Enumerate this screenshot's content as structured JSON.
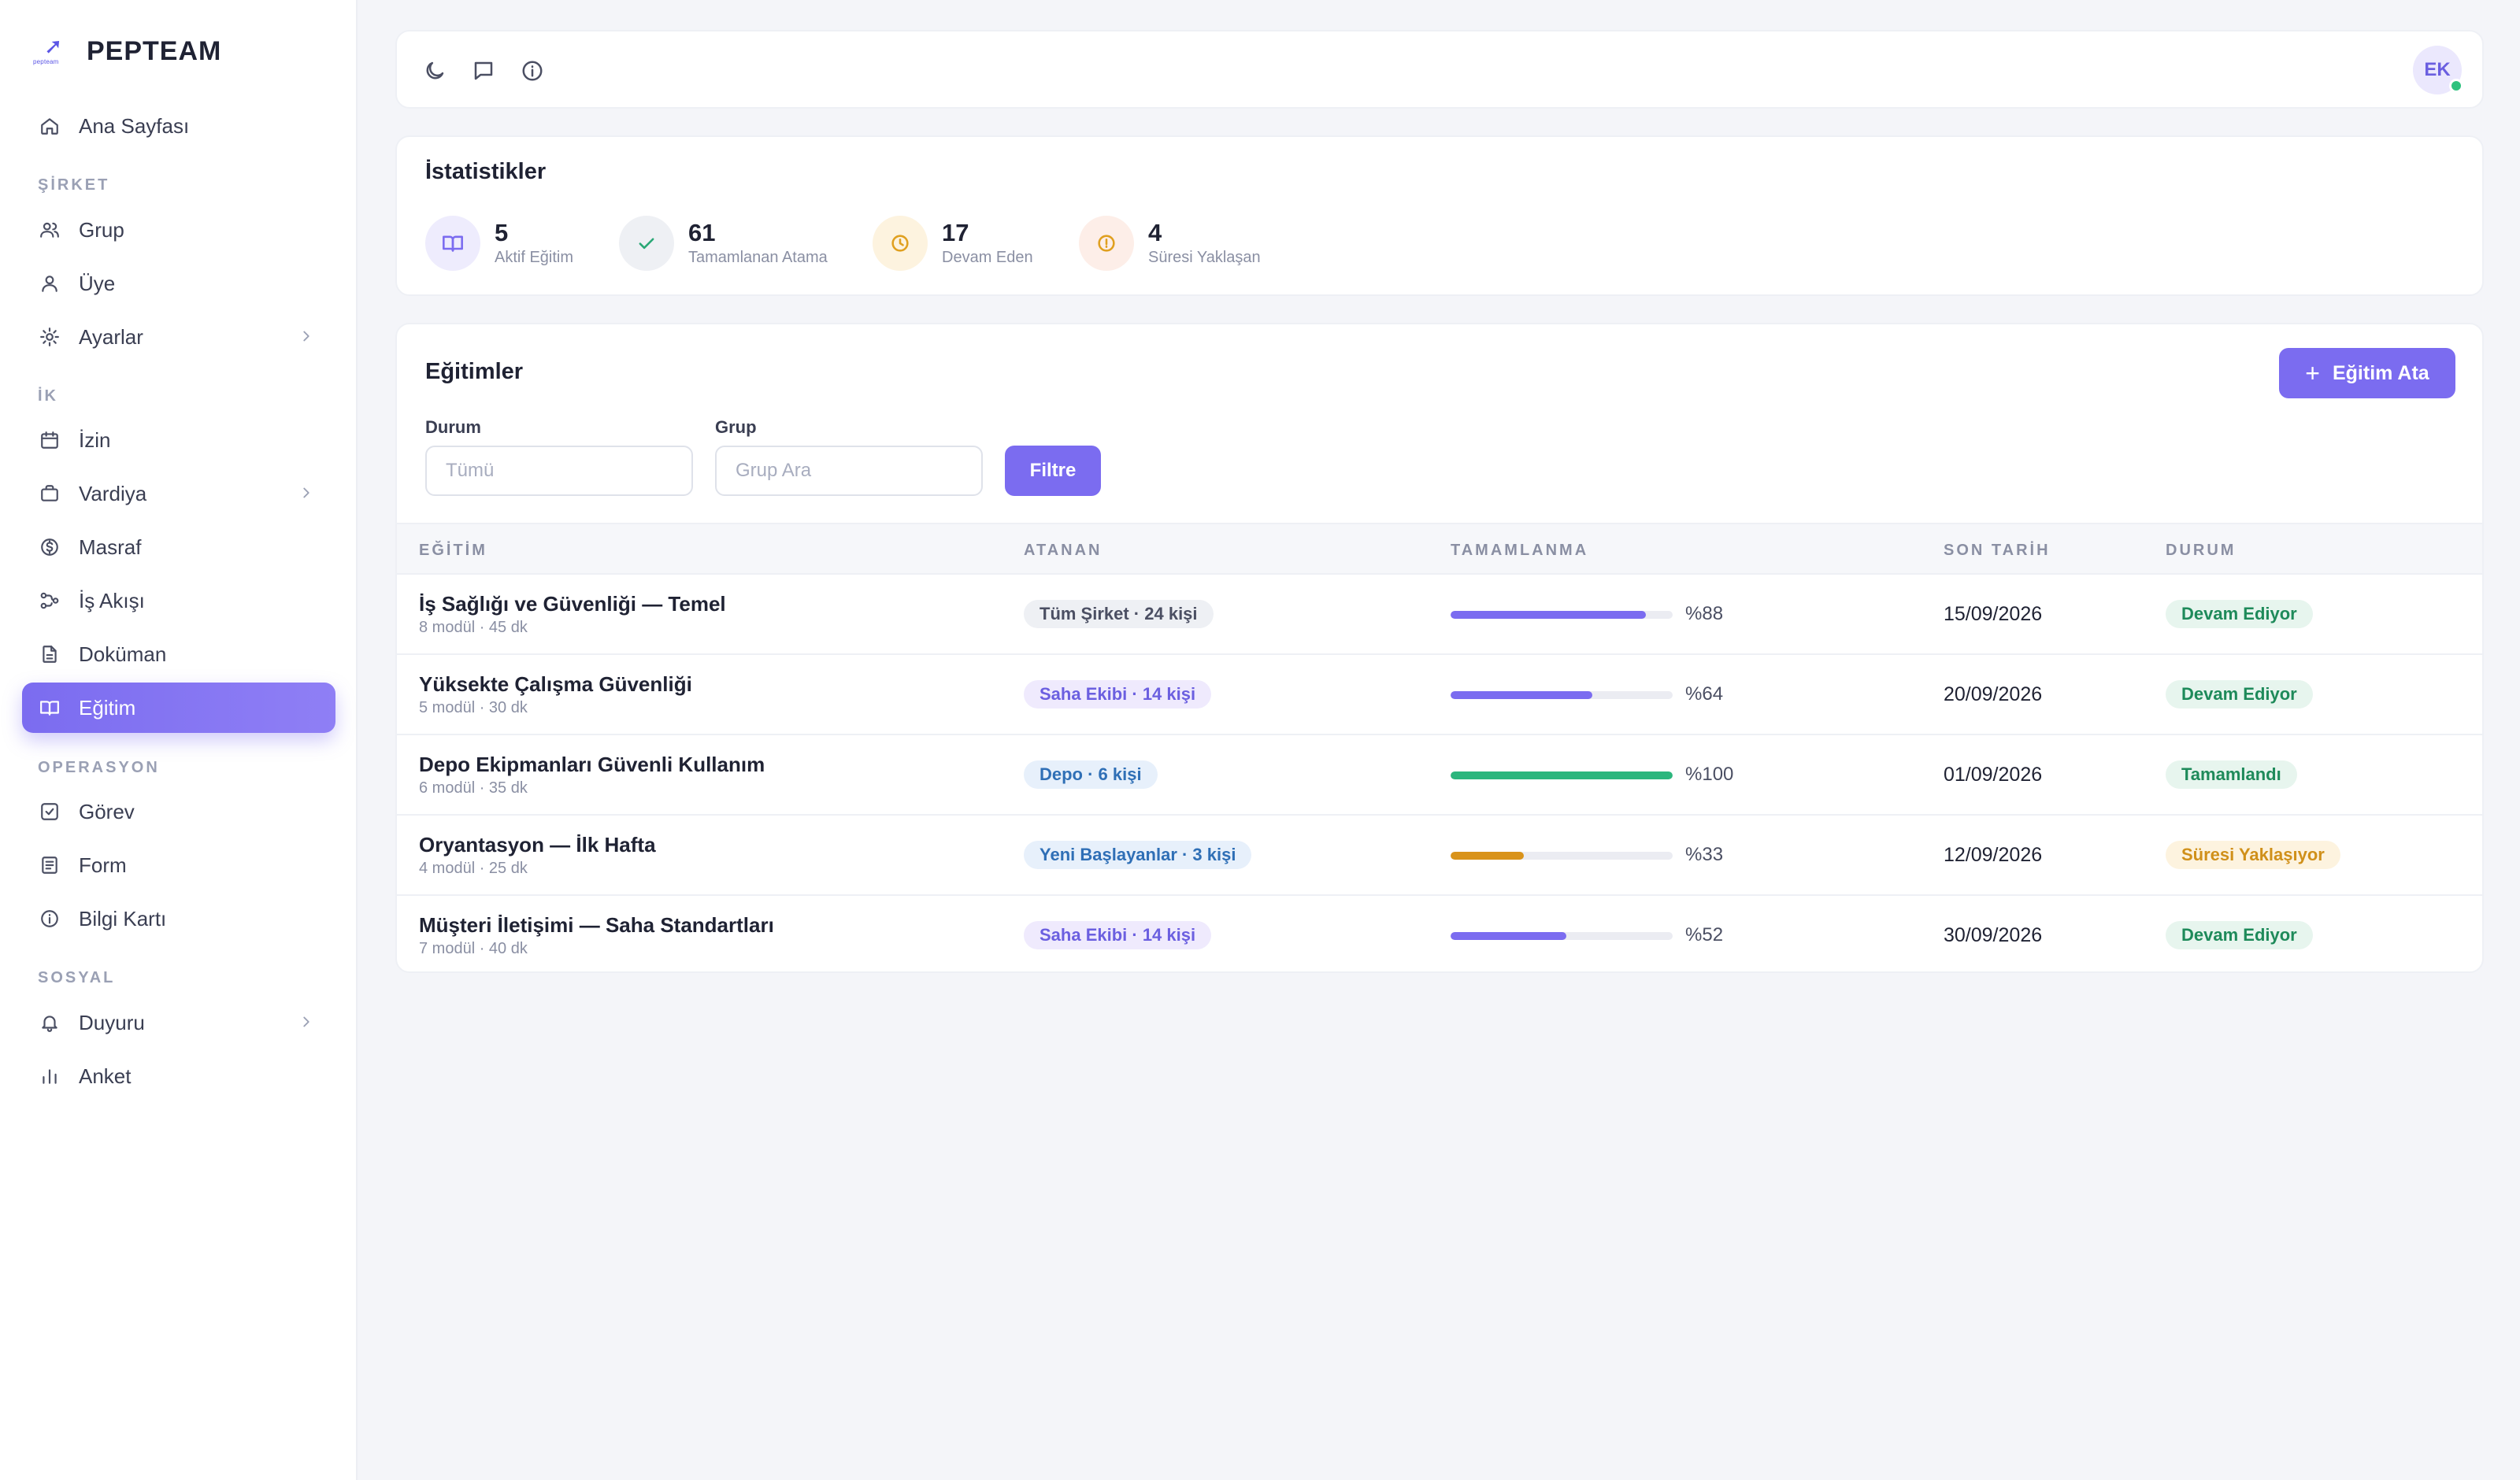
{
  "brand": {
    "name": "PEPTEAM",
    "logo_text": "pepteam"
  },
  "sidebar": {
    "home": "Ana Sayfası",
    "sections": [
      {
        "title": "ŞİRKET",
        "items": [
          {
            "label": "Grup",
            "icon": "users-icon"
          },
          {
            "label": "Üye",
            "icon": "user-icon"
          },
          {
            "label": "Ayarlar",
            "icon": "gear-icon",
            "chevron": true
          }
        ]
      },
      {
        "title": "İK",
        "items": [
          {
            "label": "İzin",
            "icon": "calendar-icon"
          },
          {
            "label": "Vardiya",
            "icon": "briefcase-icon",
            "chevron": true
          },
          {
            "label": "Masraf",
            "icon": "dollar-icon"
          },
          {
            "label": "İş Akışı",
            "icon": "workflow-icon"
          },
          {
            "label": "Doküman",
            "icon": "document-icon"
          },
          {
            "label": "Eğitim",
            "icon": "book-icon",
            "active": true
          }
        ]
      },
      {
        "title": "OPERASYON",
        "items": [
          {
            "label": "Görev",
            "icon": "check-square-icon"
          },
          {
            "label": "Form",
            "icon": "form-icon"
          },
          {
            "label": "Bilgi Kartı",
            "icon": "info-icon"
          }
        ]
      },
      {
        "title": "SOSYAL",
        "items": [
          {
            "label": "Duyuru",
            "icon": "bell-icon",
            "chevron": true
          },
          {
            "label": "Anket",
            "icon": "bar-chart-icon"
          }
        ]
      }
    ]
  },
  "topbar": {
    "icons": [
      "moon-icon",
      "message-icon",
      "info-icon"
    ],
    "avatar_initials": "EK"
  },
  "stats": {
    "title": "İstatistikler",
    "items": [
      {
        "value": "5",
        "label": "Aktif Eğitim",
        "color": "#7b6cf0",
        "bg": "#eeecfd",
        "icon": "book-icon"
      },
      {
        "value": "61",
        "label": "Tamamlanan Atama",
        "color": "#2aa876",
        "bg": "#eef0f4",
        "icon": "check-icon"
      },
      {
        "value": "17",
        "label": "Devam Eden",
        "color": "#e0a020",
        "bg": "#fdf3df",
        "icon": "clock-icon"
      },
      {
        "value": "4",
        "label": "Süresi Yaklaşan",
        "color": "#e0a020",
        "bg": "#fdeee8",
        "icon": "alert-icon"
      }
    ]
  },
  "trainings": {
    "title": "Eğitimler",
    "assign_button": "Eğitim Ata",
    "filters": {
      "status_label": "Durum",
      "status_placeholder": "Tümü",
      "group_label": "Grup",
      "group_placeholder": "Grup Ara",
      "filter_button": "Filtre"
    },
    "columns": [
      "EĞİTİM",
      "ATANAN",
      "TAMAMLANMA",
      "SON TARİH",
      "DURUM"
    ],
    "rows": [
      {
        "name": "İş Sağlığı ve Güvenliği — Temel",
        "meta": "8 modül · 45 dk",
        "assigned": "Tüm Şirket · 24 kişi",
        "chip": "gray",
        "progress": 88,
        "pct": "%88",
        "bar_color": "#7b6cf0",
        "due": "15/09/2026",
        "status": "Devam Ediyor",
        "status_style": "green"
      },
      {
        "name": "Yüksekte Çalışma Güvenliği",
        "meta": "5 modül · 30 dk",
        "assigned": "Saha Ekibi · 14 kişi",
        "chip": "purple",
        "progress": 64,
        "pct": "%64",
        "bar_color": "#7b6cf0",
        "due": "20/09/2026",
        "status": "Devam Ediyor",
        "status_style": "green"
      },
      {
        "name": "Depo Ekipmanları Güvenli Kullanım",
        "meta": "6 modül · 35 dk",
        "assigned": "Depo · 6 kişi",
        "chip": "blue",
        "progress": 100,
        "pct": "%100",
        "bar_color": "#2bb67d",
        "due": "01/09/2026",
        "status": "Tamamlandı",
        "status_style": "green"
      },
      {
        "name": "Oryantasyon — İlk Hafta",
        "meta": "4 modül · 25 dk",
        "assigned": "Yeni Başlayanlar · 3 kişi",
        "chip": "blue",
        "progress": 33,
        "pct": "%33",
        "bar_color": "#d9931a",
        "due": "12/09/2026",
        "status": "Süresi Yaklaşıyor",
        "status_style": "amber"
      },
      {
        "name": "Müşteri İletişimi — Saha Standartları",
        "meta": "7 modül · 40 dk",
        "assigned": "Saha Ekibi · 14 kişi",
        "chip": "purple",
        "progress": 52,
        "pct": "%52",
        "bar_color": "#7b6cf0",
        "due": "30/09/2026",
        "status": "Devam Ediyor",
        "status_style": "green"
      }
    ]
  }
}
